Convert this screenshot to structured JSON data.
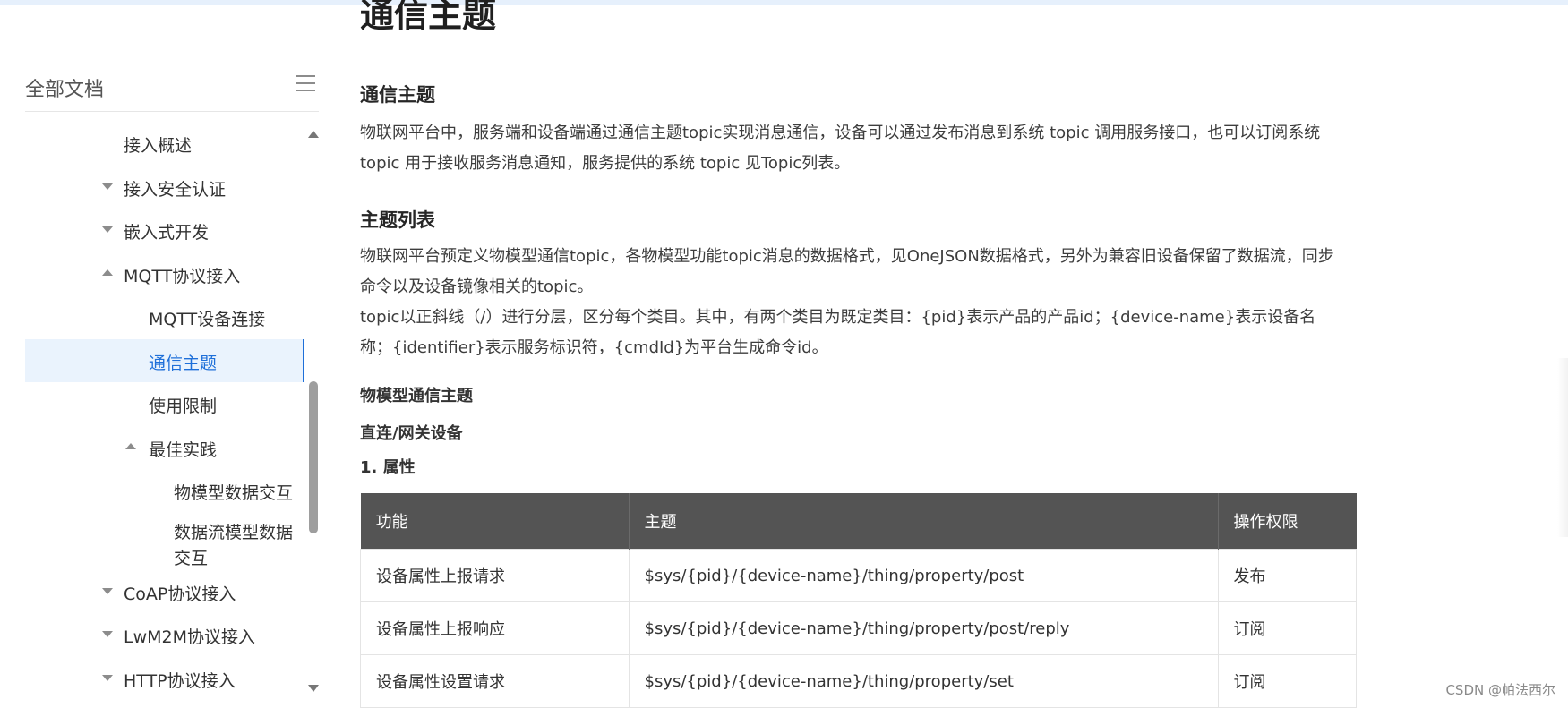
{
  "sidebar": {
    "title": "全部文档",
    "items": [
      {
        "label": "接入概述",
        "level": 1,
        "caret": "none"
      },
      {
        "label": "接入安全认证",
        "level": 1,
        "caret": "down"
      },
      {
        "label": "嵌入式开发",
        "level": 1,
        "caret": "down"
      },
      {
        "label": "MQTT协议接入",
        "level": 1,
        "caret": "up"
      },
      {
        "label": "MQTT设备连接",
        "level": 2,
        "caret": "none"
      },
      {
        "label": "通信主题",
        "level": 2,
        "caret": "none",
        "active": true
      },
      {
        "label": "使用限制",
        "level": 2,
        "caret": "none"
      },
      {
        "label": "最佳实践",
        "level": 2,
        "caret": "up"
      },
      {
        "label": "物模型数据交互",
        "level": 3,
        "caret": "none"
      },
      {
        "label": "数据流模型数据交互",
        "level": 3,
        "caret": "none"
      },
      {
        "label": "CoAP协议接入",
        "level": 1,
        "caret": "down"
      },
      {
        "label": "LwM2M协议接入",
        "level": 1,
        "caret": "down"
      },
      {
        "label": "HTTP协议接入",
        "level": 1,
        "caret": "down"
      }
    ]
  },
  "main": {
    "page_title": "通信主题",
    "section1_title": "通信主题",
    "section1_text": "物联网平台中，服务端和设备端通过通信主题topic实现消息通信，设备可以通过发布消息到系统 topic 调用服务接口，也可以订阅系统 topic 用于接收服务消息通知，服务提供的系统 topic 见Topic列表。",
    "section2_title": "主题列表",
    "section2_text1": "物联网平台预定义物模型通信topic，各物模型功能topic消息的数据格式，见OneJSON数据格式，另外为兼容旧设备保留了数据流，同步命令以及设备镜像相关的topic。",
    "section2_text2": "topic以正斜线（/）进行分层，区分每个类目。其中，有两个类目为既定类目：{pid}表示产品的产品id；{device-name}表示设备名称；{identifier}表示服务标识符，{cmdId}为平台生成命令id。",
    "sub1": "物模型通信主题",
    "sub2": "直连/网关设备",
    "sub3": "1. 属性",
    "table": {
      "headers": [
        "功能",
        "主题",
        "操作权限"
      ],
      "rows": [
        [
          "设备属性上报请求",
          "$sys/{pid}/{device-name}/thing/property/post",
          "发布"
        ],
        [
          "设备属性上报响应",
          "$sys/{pid}/{device-name}/thing/property/post/reply",
          "订阅"
        ],
        [
          "设备属性设置请求",
          "$sys/{pid}/{device-name}/thing/property/set",
          "订阅"
        ]
      ]
    }
  },
  "watermark": "CSDN @帕法西尔",
  "colors": {
    "accent": "#1e6fd9",
    "active_bg": "#eaf3fd",
    "table_header": "#545454"
  }
}
